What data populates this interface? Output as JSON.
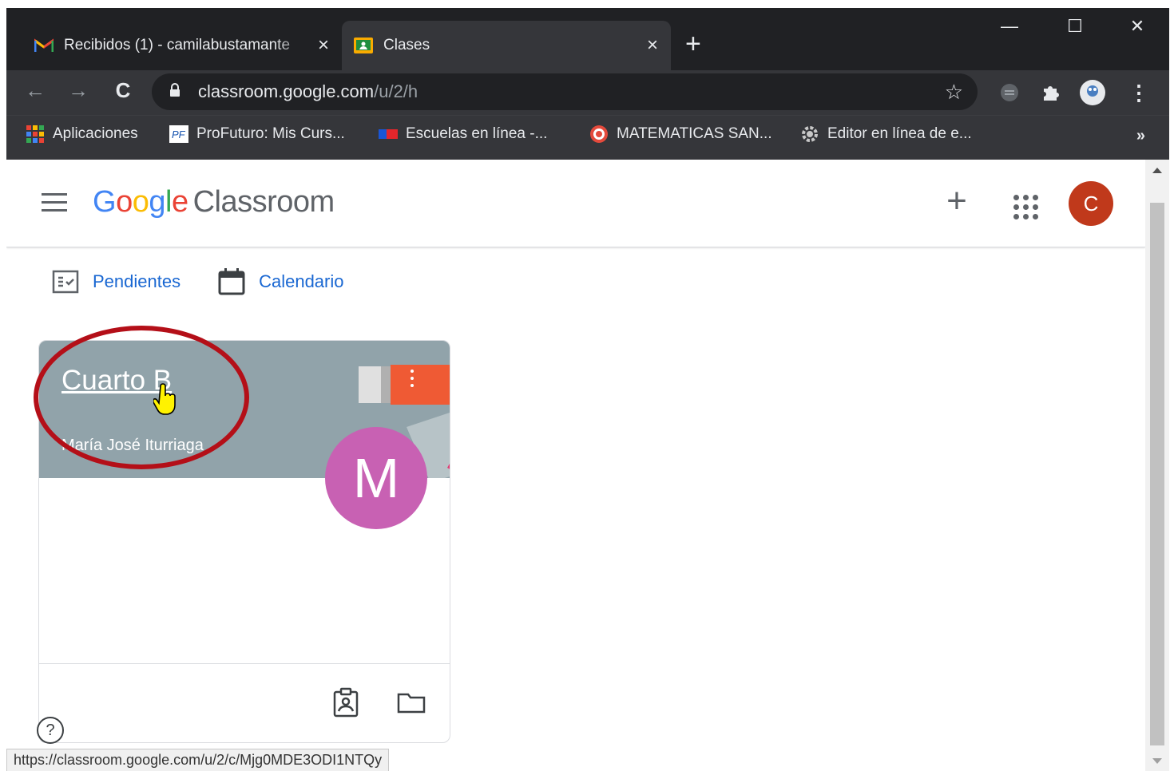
{
  "colors": {
    "chrome_dark": "#202124",
    "chrome_toolbar": "#35363a",
    "link_blue": "#1967d2",
    "card_header": "#91a3aa",
    "card_avatar": "#c861b3",
    "user_avatar": "#c0391b",
    "highlight_red": "#b40f18"
  },
  "browser": {
    "tabs": [
      {
        "title": "Recibidos (1) - camilabustamante",
        "icon": "gmail-icon",
        "close": "×"
      },
      {
        "title": "Clases",
        "icon": "classroom-icon",
        "close": "×"
      }
    ],
    "new_tab": "+",
    "window_controls": {
      "minimize": "—",
      "maximize": "☐",
      "close": "✕"
    },
    "nav": {
      "back": "←",
      "forward": "→",
      "reload": "C"
    },
    "url": {
      "domain": "classroom.google.com",
      "path": "/u/2/h"
    },
    "star": "☆",
    "menu": "⋮",
    "bookmarks": [
      {
        "label": "Aplicaciones",
        "icon": "apps-grid-icon"
      },
      {
        "label": "ProFuturo: Mis Curs...",
        "icon": "profuturo-icon"
      },
      {
        "label": "Escuelas en línea -...",
        "icon": "flag-icon"
      },
      {
        "label": "MATEMATICAS SAN...",
        "icon": "target-icon"
      },
      {
        "label": "Editor en línea de e...",
        "icon": "gear-icon"
      }
    ],
    "bookmarks_more": "»"
  },
  "app": {
    "logo_google": "Google",
    "logo_product": "Classroom",
    "add_label": "+",
    "user_initial": "C"
  },
  "subnav": {
    "pendientes": "Pendientes",
    "calendario": "Calendario"
  },
  "class_card": {
    "title": "Cuarto B",
    "teacher": "María José Iturriaga",
    "teacher_initial": "M"
  },
  "help": "?",
  "status_url": "https://classroom.google.com/u/2/c/Mjg0MDE3ODI1NTQy"
}
